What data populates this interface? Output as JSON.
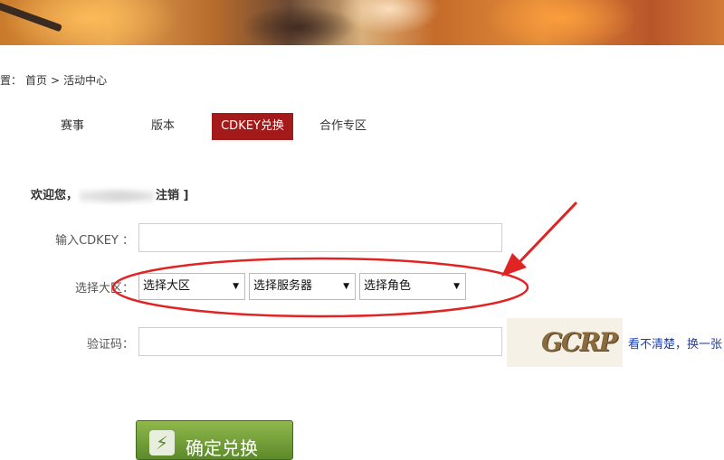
{
  "breadcrumb": {
    "prefix": "置：",
    "home": "首页",
    "sep": ">",
    "current": "活动中心"
  },
  "tabs": [
    {
      "label": "赛事"
    },
    {
      "label": "版本"
    },
    {
      "label": "CDKEY兑换"
    },
    {
      "label": "合作专区"
    }
  ],
  "welcome": {
    "greeting": "欢迎您，",
    "logout": "注销 ]"
  },
  "form": {
    "cdkey_label": "输入CDKEY ：",
    "cdkey_value": "",
    "region_label": "选择大区：",
    "region_select": "选择大区",
    "server_select": "选择服务器",
    "role_select": "选择角色",
    "captcha_label": "验证码：",
    "captcha_value": "",
    "captcha_text": "GCRP",
    "refresh_text": "看不清楚，换一张",
    "submit_label": "确定兑换"
  },
  "colors": {
    "active_tab": "#a41a1a",
    "annotation": "#e02424",
    "link": "#1a3fb0",
    "submit": "#5d8a2a"
  }
}
